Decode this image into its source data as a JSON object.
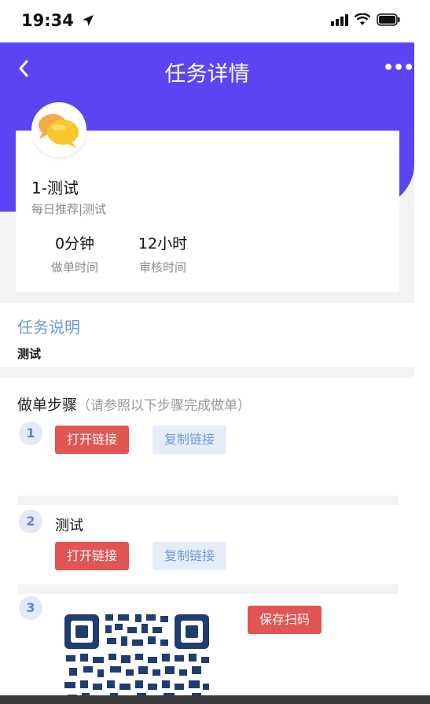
{
  "status": {
    "time": "19:34"
  },
  "header": {
    "title": "任务详情"
  },
  "task": {
    "name": "1-测试",
    "category": "每日推荐|测试",
    "stats": [
      {
        "value": "0分钟",
        "label": "做单时间"
      },
      {
        "value": "12小时",
        "label": "审核时间"
      }
    ]
  },
  "description": {
    "title": "任务说明",
    "body": "测试"
  },
  "steps": {
    "title": "做单步骤",
    "hint": "（请参照以下步骤完成做单）",
    "items": [
      {
        "number": "1",
        "text": "",
        "open_label": "打开链接",
        "copy_label": "复制链接"
      },
      {
        "number": "2",
        "text": "测试",
        "open_label": "打开链接",
        "copy_label": "复制链接"
      },
      {
        "number": "3",
        "save_label": "保存扫码"
      }
    ]
  },
  "colors": {
    "header": "#5b45f2",
    "accent_red": "#e15552",
    "link_blue": "#6f9bd1"
  }
}
